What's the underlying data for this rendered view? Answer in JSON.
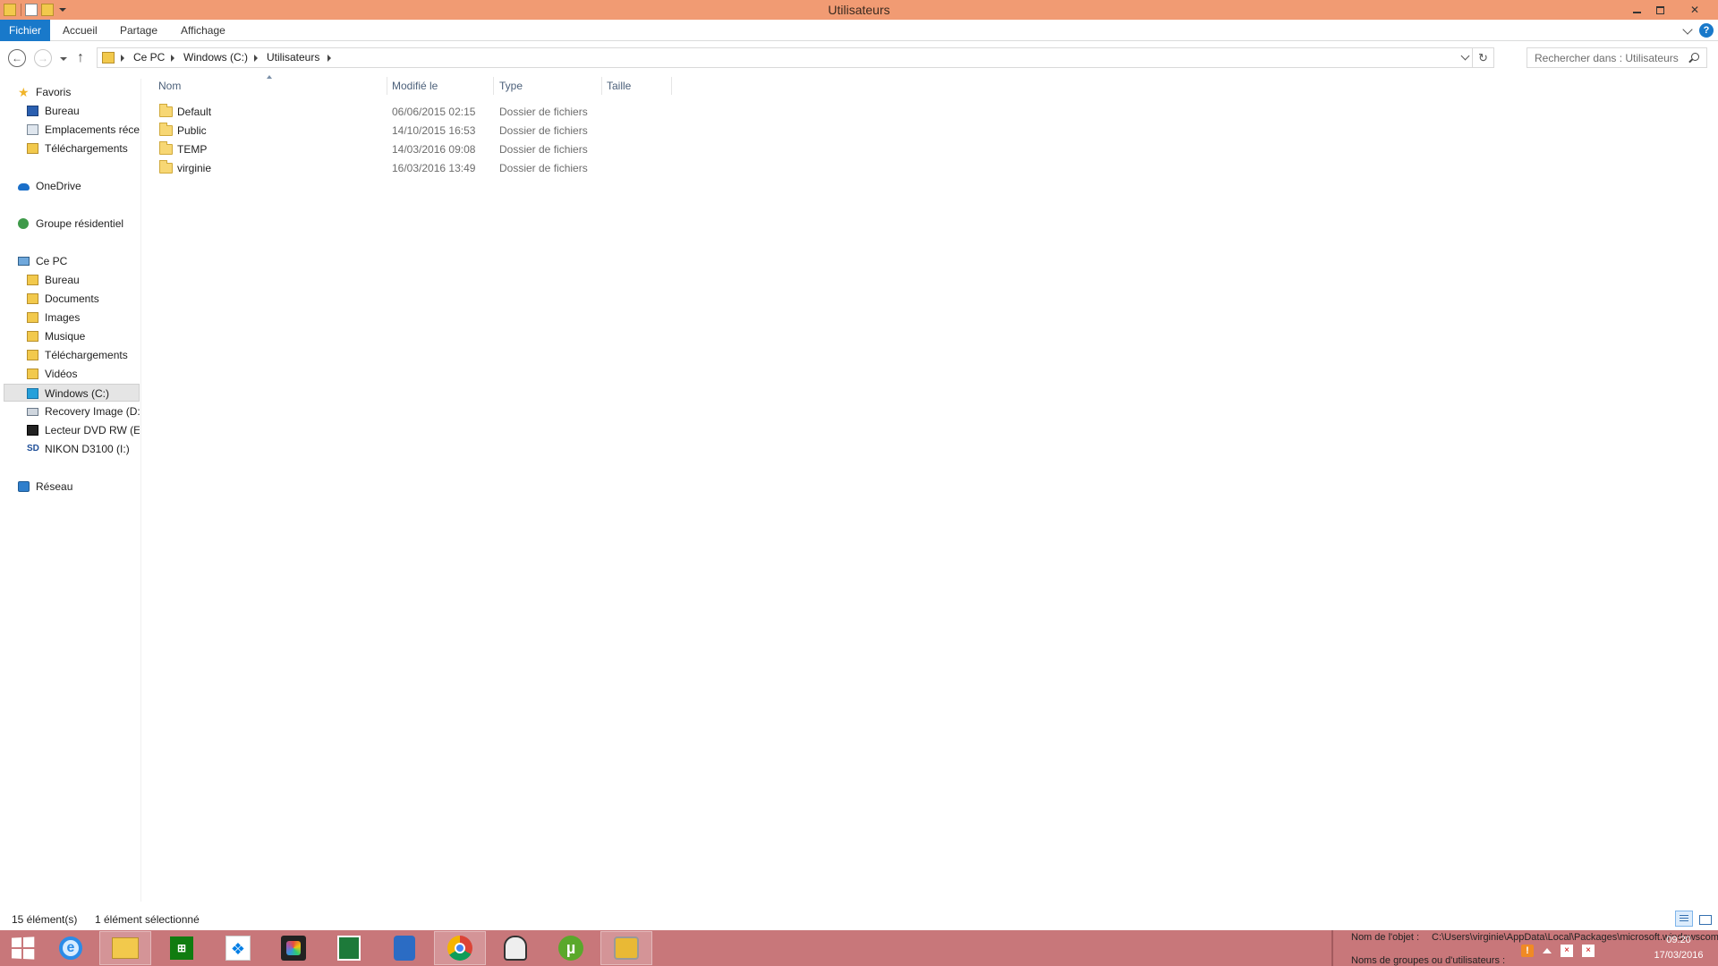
{
  "window": {
    "title": "Utilisateurs"
  },
  "ribbon": {
    "tabs": [
      "Fichier",
      "Accueil",
      "Partage",
      "Affichage"
    ],
    "help": "?"
  },
  "address": {
    "crumbs": [
      "Ce PC",
      "Windows (C:)",
      "Utilisateurs"
    ],
    "search_placeholder": "Rechercher dans : Utilisateurs"
  },
  "navigation": {
    "favorites": {
      "label": "Favoris",
      "items": [
        "Bureau",
        "Emplacements récents",
        "Téléchargements"
      ]
    },
    "onedrive": "OneDrive",
    "homegroup": "Groupe résidentiel",
    "this_pc": {
      "label": "Ce PC",
      "items": [
        "Bureau",
        "Documents",
        "Images",
        "Musique",
        "Téléchargements",
        "Vidéos",
        "Windows (C:)",
        "Recovery Image (D:)",
        "Lecteur DVD RW (E:)",
        "NIKON D3100 (I:)"
      ]
    },
    "network": "Réseau"
  },
  "filelist": {
    "columns": {
      "name": "Nom",
      "modified": "Modifié le",
      "type": "Type",
      "size": "Taille"
    },
    "rows": [
      {
        "name": "Default",
        "modified": "06/06/2015 02:15",
        "type": "Dossier de fichiers"
      },
      {
        "name": "Public",
        "modified": "14/10/2015 16:53",
        "type": "Dossier de fichiers"
      },
      {
        "name": "TEMP",
        "modified": "14/03/2016 09:08",
        "type": "Dossier de fichiers"
      },
      {
        "name": "virginie",
        "modified": "16/03/2016 13:49",
        "type": "Dossier de fichiers"
      }
    ]
  },
  "statusbar": {
    "count": "15 élément(s)",
    "selected": "1 élément sélectionné"
  },
  "taskbar": {
    "tooltip_label1": "Nom de l'objet :",
    "tooltip_value1": "C:\\Users\\virginie\\AppData\\Local\\Packages\\microsoft.windowscom",
    "tooltip_label2": "Noms de groupes ou d'utilisateurs :",
    "ie_glyph": "e",
    "store_glyph": "⊞",
    "dropbox_glyph": "❖",
    "utorrent_glyph": "µ",
    "clock_time": "09:20",
    "clock_date": "17/03/2016",
    "warn_glyph": "!",
    "x_glyph": "×"
  }
}
